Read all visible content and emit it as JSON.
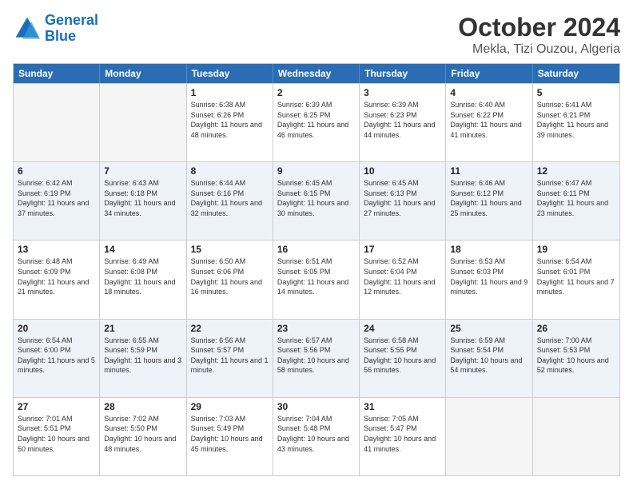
{
  "header": {
    "logo_general": "General",
    "logo_blue": "Blue",
    "month": "October 2024",
    "location": "Mekla, Tizi Ouzou, Algeria"
  },
  "days_of_week": [
    "Sunday",
    "Monday",
    "Tuesday",
    "Wednesday",
    "Thursday",
    "Friday",
    "Saturday"
  ],
  "weeks": [
    [
      {
        "day": "",
        "sunrise": "",
        "sunset": "",
        "daylight": "",
        "empty": true
      },
      {
        "day": "",
        "sunrise": "",
        "sunset": "",
        "daylight": "",
        "empty": true
      },
      {
        "day": "1",
        "sunrise": "Sunrise: 6:38 AM",
        "sunset": "Sunset: 6:26 PM",
        "daylight": "Daylight: 11 hours and 48 minutes.",
        "empty": false
      },
      {
        "day": "2",
        "sunrise": "Sunrise: 6:39 AM",
        "sunset": "Sunset: 6:25 PM",
        "daylight": "Daylight: 11 hours and 46 minutes.",
        "empty": false
      },
      {
        "day": "3",
        "sunrise": "Sunrise: 6:39 AM",
        "sunset": "Sunset: 6:23 PM",
        "daylight": "Daylight: 11 hours and 44 minutes.",
        "empty": false
      },
      {
        "day": "4",
        "sunrise": "Sunrise: 6:40 AM",
        "sunset": "Sunset: 6:22 PM",
        "daylight": "Daylight: 11 hours and 41 minutes.",
        "empty": false
      },
      {
        "day": "5",
        "sunrise": "Sunrise: 6:41 AM",
        "sunset": "Sunset: 6:21 PM",
        "daylight": "Daylight: 11 hours and 39 minutes.",
        "empty": false
      }
    ],
    [
      {
        "day": "6",
        "sunrise": "Sunrise: 6:42 AM",
        "sunset": "Sunset: 6:19 PM",
        "daylight": "Daylight: 11 hours and 37 minutes.",
        "empty": false
      },
      {
        "day": "7",
        "sunrise": "Sunrise: 6:43 AM",
        "sunset": "Sunset: 6:18 PM",
        "daylight": "Daylight: 11 hours and 34 minutes.",
        "empty": false
      },
      {
        "day": "8",
        "sunrise": "Sunrise: 6:44 AM",
        "sunset": "Sunset: 6:16 PM",
        "daylight": "Daylight: 11 hours and 32 minutes.",
        "empty": false
      },
      {
        "day": "9",
        "sunrise": "Sunrise: 6:45 AM",
        "sunset": "Sunset: 6:15 PM",
        "daylight": "Daylight: 11 hours and 30 minutes.",
        "empty": false
      },
      {
        "day": "10",
        "sunrise": "Sunrise: 6:45 AM",
        "sunset": "Sunset: 6:13 PM",
        "daylight": "Daylight: 11 hours and 27 minutes.",
        "empty": false
      },
      {
        "day": "11",
        "sunrise": "Sunrise: 6:46 AM",
        "sunset": "Sunset: 6:12 PM",
        "daylight": "Daylight: 11 hours and 25 minutes.",
        "empty": false
      },
      {
        "day": "12",
        "sunrise": "Sunrise: 6:47 AM",
        "sunset": "Sunset: 6:11 PM",
        "daylight": "Daylight: 11 hours and 23 minutes.",
        "empty": false
      }
    ],
    [
      {
        "day": "13",
        "sunrise": "Sunrise: 6:48 AM",
        "sunset": "Sunset: 6:09 PM",
        "daylight": "Daylight: 11 hours and 21 minutes.",
        "empty": false
      },
      {
        "day": "14",
        "sunrise": "Sunrise: 6:49 AM",
        "sunset": "Sunset: 6:08 PM",
        "daylight": "Daylight: 11 hours and 18 minutes.",
        "empty": false
      },
      {
        "day": "15",
        "sunrise": "Sunrise: 6:50 AM",
        "sunset": "Sunset: 6:06 PM",
        "daylight": "Daylight: 11 hours and 16 minutes.",
        "empty": false
      },
      {
        "day": "16",
        "sunrise": "Sunrise: 6:51 AM",
        "sunset": "Sunset: 6:05 PM",
        "daylight": "Daylight: 11 hours and 14 minutes.",
        "empty": false
      },
      {
        "day": "17",
        "sunrise": "Sunrise: 6:52 AM",
        "sunset": "Sunset: 6:04 PM",
        "daylight": "Daylight: 11 hours and 12 minutes.",
        "empty": false
      },
      {
        "day": "18",
        "sunrise": "Sunrise: 6:53 AM",
        "sunset": "Sunset: 6:03 PM",
        "daylight": "Daylight: 11 hours and 9 minutes.",
        "empty": false
      },
      {
        "day": "19",
        "sunrise": "Sunrise: 6:54 AM",
        "sunset": "Sunset: 6:01 PM",
        "daylight": "Daylight: 11 hours and 7 minutes.",
        "empty": false
      }
    ],
    [
      {
        "day": "20",
        "sunrise": "Sunrise: 6:54 AM",
        "sunset": "Sunset: 6:00 PM",
        "daylight": "Daylight: 11 hours and 5 minutes.",
        "empty": false
      },
      {
        "day": "21",
        "sunrise": "Sunrise: 6:55 AM",
        "sunset": "Sunset: 5:59 PM",
        "daylight": "Daylight: 11 hours and 3 minutes.",
        "empty": false
      },
      {
        "day": "22",
        "sunrise": "Sunrise: 6:56 AM",
        "sunset": "Sunset: 5:57 PM",
        "daylight": "Daylight: 11 hours and 1 minute.",
        "empty": false
      },
      {
        "day": "23",
        "sunrise": "Sunrise: 6:57 AM",
        "sunset": "Sunset: 5:56 PM",
        "daylight": "Daylight: 10 hours and 58 minutes.",
        "empty": false
      },
      {
        "day": "24",
        "sunrise": "Sunrise: 6:58 AM",
        "sunset": "Sunset: 5:55 PM",
        "daylight": "Daylight: 10 hours and 56 minutes.",
        "empty": false
      },
      {
        "day": "25",
        "sunrise": "Sunrise: 6:59 AM",
        "sunset": "Sunset: 5:54 PM",
        "daylight": "Daylight: 10 hours and 54 minutes.",
        "empty": false
      },
      {
        "day": "26",
        "sunrise": "Sunrise: 7:00 AM",
        "sunset": "Sunset: 5:53 PM",
        "daylight": "Daylight: 10 hours and 52 minutes.",
        "empty": false
      }
    ],
    [
      {
        "day": "27",
        "sunrise": "Sunrise: 7:01 AM",
        "sunset": "Sunset: 5:51 PM",
        "daylight": "Daylight: 10 hours and 50 minutes.",
        "empty": false
      },
      {
        "day": "28",
        "sunrise": "Sunrise: 7:02 AM",
        "sunset": "Sunset: 5:50 PM",
        "daylight": "Daylight: 10 hours and 48 minutes.",
        "empty": false
      },
      {
        "day": "29",
        "sunrise": "Sunrise: 7:03 AM",
        "sunset": "Sunset: 5:49 PM",
        "daylight": "Daylight: 10 hours and 45 minutes.",
        "empty": false
      },
      {
        "day": "30",
        "sunrise": "Sunrise: 7:04 AM",
        "sunset": "Sunset: 5:48 PM",
        "daylight": "Daylight: 10 hours and 43 minutes.",
        "empty": false
      },
      {
        "day": "31",
        "sunrise": "Sunrise: 7:05 AM",
        "sunset": "Sunset: 5:47 PM",
        "daylight": "Daylight: 10 hours and 41 minutes.",
        "empty": false
      },
      {
        "day": "",
        "sunrise": "",
        "sunset": "",
        "daylight": "",
        "empty": true
      },
      {
        "day": "",
        "sunrise": "",
        "sunset": "",
        "daylight": "",
        "empty": true
      }
    ]
  ]
}
